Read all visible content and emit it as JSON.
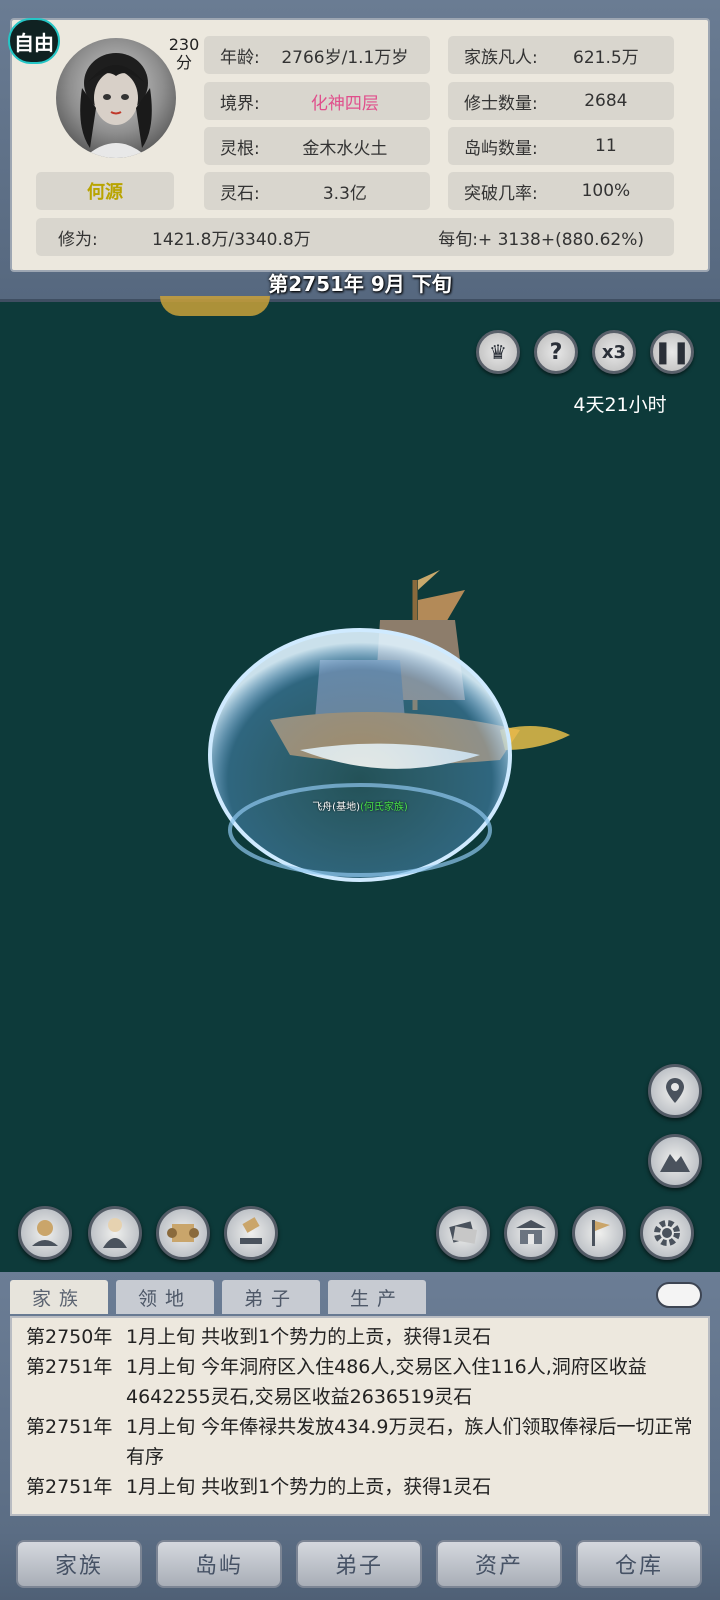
{
  "status": {
    "free_badge": "自由",
    "score": "230\n分",
    "name": "何源",
    "rows": [
      {
        "key": "年龄:",
        "value": "2766岁/1.1万岁"
      },
      {
        "key": "境界:",
        "value": "化神四层"
      },
      {
        "key": "灵根:",
        "value": "金木水火土"
      },
      {
        "key": "灵石:",
        "value": "3.3亿"
      }
    ],
    "rows_right": [
      {
        "key": "家族凡人:",
        "value": "621.5万"
      },
      {
        "key": "修士数量:",
        "value": "2684"
      },
      {
        "key": "岛屿数量:",
        "value": "11"
      },
      {
        "key": "突破几率:",
        "value": "100%"
      }
    ],
    "cultivation_label": "修为:",
    "cultivation_value": "1421.8万/3340.8万",
    "per_period": "每旬:+ 3138+(880.62%)"
  },
  "date": "第2751年 9月 下旬",
  "timer": "4天21小时",
  "speed_label": "x3",
  "ship_label": {
    "name": "飞舟(基地)",
    "faction": "(何氏家族)"
  },
  "log": {
    "tabs": [
      "家族",
      "领地",
      "弟子",
      "生产"
    ],
    "entries": [
      {
        "date": "第2750年",
        "text": "1月上旬 共收到1个势力的上贡，获得1灵石"
      },
      {
        "date": "第2751年",
        "text": "1月上旬 今年洞府区入住486人,交易区入住116人,洞府区收益4642255灵石,交易区收益2636519灵石"
      },
      {
        "date": "第2751年",
        "text": "1月上旬 今年俸禄共发放434.9万灵石，族人们领取俸禄后一切正常有序"
      },
      {
        "date": "第2751年",
        "text": "1月上旬 共收到1个势力的上贡，获得1灵石"
      }
    ]
  },
  "nav": [
    "家族",
    "岛屿",
    "弟子",
    "资产",
    "仓库"
  ],
  "colors": {
    "realm": "#e04f8c",
    "map_bg": "#0d3a3a",
    "name": "#b9a400"
  }
}
